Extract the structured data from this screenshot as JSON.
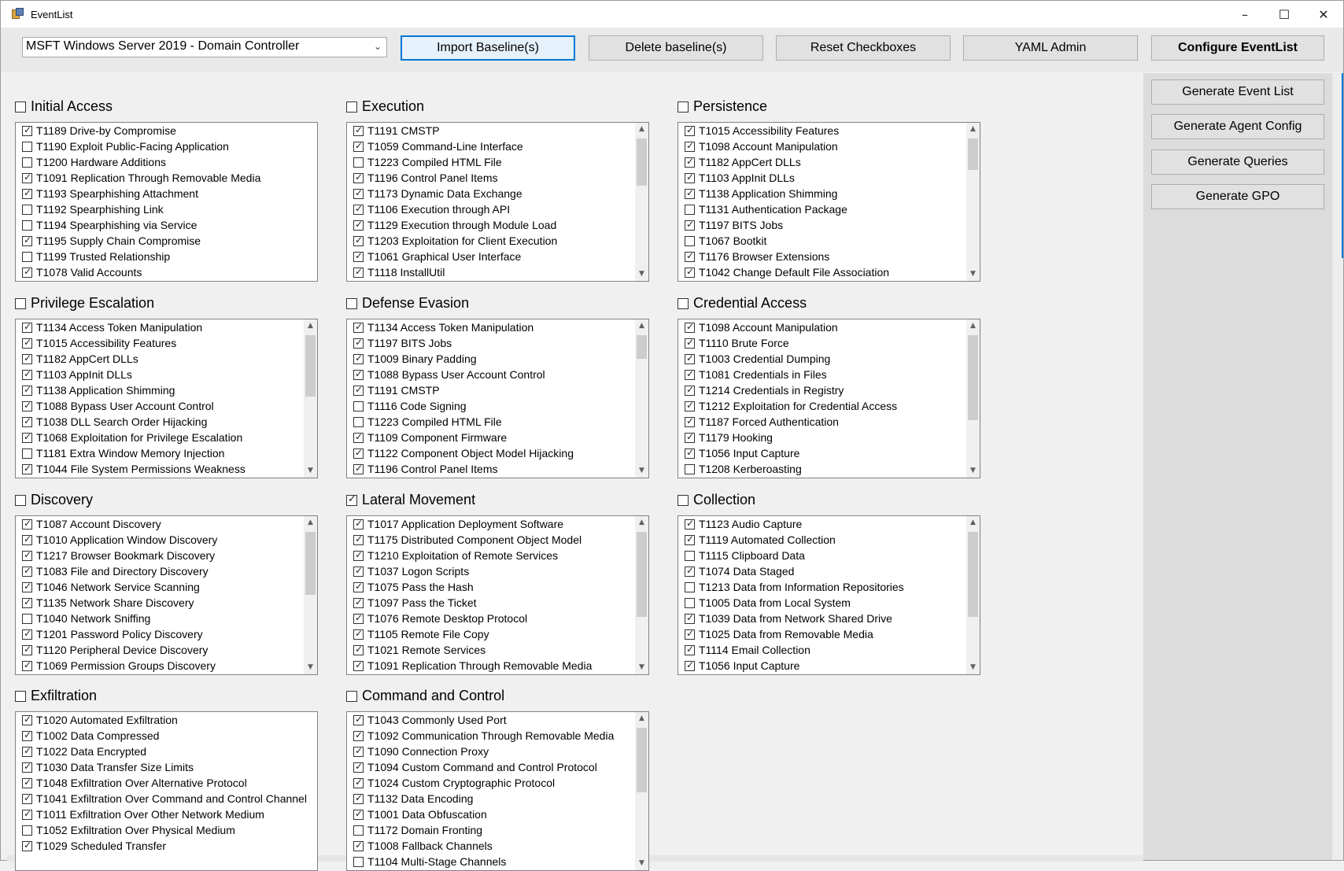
{
  "window": {
    "title": "EventList",
    "controls": [
      "minimize-icon",
      "maximize-icon",
      "close-icon"
    ]
  },
  "toolbar": {
    "baseline_selected": "MSFT Windows Server 2019 - Domain Controller",
    "import_label": "Import Baseline(s)",
    "delete_label": "Delete baseline(s)",
    "reset_label": "Reset Checkboxes",
    "yaml_label": "YAML Admin",
    "configure_label": "Configure EventList"
  },
  "sidepanel": {
    "generate_event_list": "Generate Event List",
    "generate_agent_config": "Generate Agent Config",
    "generate_queries": "Generate Queries",
    "generate_gpo": "Generate GPO"
  },
  "groups": [
    {
      "title": "Initial Access",
      "checked": false,
      "has_scroll": false,
      "items": [
        {
          "label": "T1189 Drive-by Compromise",
          "checked": true
        },
        {
          "label": "T1190 Exploit Public-Facing Application",
          "checked": false
        },
        {
          "label": "T1200 Hardware Additions",
          "checked": false
        },
        {
          "label": "T1091 Replication Through Removable Media",
          "checked": true
        },
        {
          "label": "T1193 Spearphishing Attachment",
          "checked": true
        },
        {
          "label": "T1192 Spearphishing Link",
          "checked": false
        },
        {
          "label": "T1194 Spearphishing via Service",
          "checked": false
        },
        {
          "label": "T1195 Supply Chain Compromise",
          "checked": true
        },
        {
          "label": "T1199 Trusted Relationship",
          "checked": false
        },
        {
          "label": "T1078 Valid Accounts",
          "checked": true
        }
      ]
    },
    {
      "title": "Execution",
      "checked": false,
      "has_scroll": true,
      "items": [
        {
          "label": "T1191 CMSTP",
          "checked": true
        },
        {
          "label": "T1059 Command-Line Interface",
          "checked": true
        },
        {
          "label": "T1223 Compiled HTML File",
          "checked": false
        },
        {
          "label": "T1196 Control Panel Items",
          "checked": true
        },
        {
          "label": "T1173 Dynamic Data Exchange",
          "checked": true
        },
        {
          "label": "T1106 Execution through API",
          "checked": true
        },
        {
          "label": "T1129 Execution through Module Load",
          "checked": true
        },
        {
          "label": "T1203 Exploitation for Client Execution",
          "checked": true
        },
        {
          "label": "T1061 Graphical User Interface",
          "checked": true
        },
        {
          "label": "T1118 InstallUtil",
          "checked": true
        }
      ]
    },
    {
      "title": "Persistence",
      "checked": false,
      "has_scroll": true,
      "items": [
        {
          "label": "T1015 Accessibility Features",
          "checked": true
        },
        {
          "label": "T1098 Account Manipulation",
          "checked": true
        },
        {
          "label": "T1182 AppCert DLLs",
          "checked": true
        },
        {
          "label": "T1103 AppInit DLLs",
          "checked": true
        },
        {
          "label": "T1138 Application Shimming",
          "checked": true
        },
        {
          "label": "T1131 Authentication Package",
          "checked": false
        },
        {
          "label": "T1197 BITS Jobs",
          "checked": true
        },
        {
          "label": "T1067 Bootkit",
          "checked": false
        },
        {
          "label": "T1176 Browser Extensions",
          "checked": true
        },
        {
          "label": "T1042 Change Default File Association",
          "checked": true
        }
      ]
    },
    {
      "title": "Privilege Escalation",
      "checked": false,
      "has_scroll": true,
      "items": [
        {
          "label": "T1134 Access Token Manipulation",
          "checked": true
        },
        {
          "label": "T1015 Accessibility Features",
          "checked": true
        },
        {
          "label": "T1182 AppCert DLLs",
          "checked": true
        },
        {
          "label": "T1103 AppInit DLLs",
          "checked": true
        },
        {
          "label": "T1138 Application Shimming",
          "checked": true
        },
        {
          "label": "T1088 Bypass User Account Control",
          "checked": true
        },
        {
          "label": "T1038 DLL Search Order Hijacking",
          "checked": true
        },
        {
          "label": "T1068 Exploitation for Privilege Escalation",
          "checked": true
        },
        {
          "label": "T1181 Extra Window Memory Injection",
          "checked": false
        },
        {
          "label": "T1044 File System Permissions Weakness",
          "checked": true
        }
      ]
    },
    {
      "title": "Defense Evasion",
      "checked": false,
      "has_scroll": true,
      "items": [
        {
          "label": "T1134 Access Token Manipulation",
          "checked": true
        },
        {
          "label": "T1197 BITS Jobs",
          "checked": true
        },
        {
          "label": "T1009 Binary Padding",
          "checked": true
        },
        {
          "label": "T1088 Bypass User Account Control",
          "checked": true
        },
        {
          "label": "T1191 CMSTP",
          "checked": true
        },
        {
          "label": "T1116 Code Signing",
          "checked": false
        },
        {
          "label": "T1223 Compiled HTML File",
          "checked": false
        },
        {
          "label": "T1109 Component Firmware",
          "checked": true
        },
        {
          "label": "T1122 Component Object Model Hijacking",
          "checked": true
        },
        {
          "label": "T1196 Control Panel Items",
          "checked": true
        }
      ]
    },
    {
      "title": "Credential Access",
      "checked": false,
      "has_scroll": true,
      "items": [
        {
          "label": "T1098 Account Manipulation",
          "checked": true
        },
        {
          "label": "T1110 Brute Force",
          "checked": true
        },
        {
          "label": "T1003 Credential Dumping",
          "checked": true
        },
        {
          "label": "T1081 Credentials in Files",
          "checked": true
        },
        {
          "label": "T1214 Credentials in Registry",
          "checked": true
        },
        {
          "label": "T1212 Exploitation for Credential Access",
          "checked": true
        },
        {
          "label": "T1187 Forced Authentication",
          "checked": true
        },
        {
          "label": "T1179 Hooking",
          "checked": true
        },
        {
          "label": "T1056 Input Capture",
          "checked": true
        },
        {
          "label": "T1208 Kerberoasting",
          "checked": false
        }
      ]
    },
    {
      "title": "Discovery",
      "checked": false,
      "has_scroll": true,
      "items": [
        {
          "label": "T1087 Account Discovery",
          "checked": true
        },
        {
          "label": "T1010 Application Window Discovery",
          "checked": true
        },
        {
          "label": "T1217 Browser Bookmark Discovery",
          "checked": true
        },
        {
          "label": "T1083 File and Directory Discovery",
          "checked": true
        },
        {
          "label": "T1046 Network Service Scanning",
          "checked": true
        },
        {
          "label": "T1135 Network Share Discovery",
          "checked": true
        },
        {
          "label": "T1040 Network Sniffing",
          "checked": false
        },
        {
          "label": "T1201 Password Policy Discovery",
          "checked": true
        },
        {
          "label": "T1120 Peripheral Device Discovery",
          "checked": true
        },
        {
          "label": "T1069 Permission Groups Discovery",
          "checked": true
        }
      ]
    },
    {
      "title": "Lateral Movement",
      "checked": true,
      "has_scroll": true,
      "items": [
        {
          "label": "T1017 Application Deployment Software",
          "checked": true
        },
        {
          "label": "T1175 Distributed Component Object Model",
          "checked": true
        },
        {
          "label": "T1210 Exploitation of Remote Services",
          "checked": true
        },
        {
          "label": "T1037 Logon Scripts",
          "checked": true
        },
        {
          "label": "T1075 Pass the Hash",
          "checked": true
        },
        {
          "label": "T1097 Pass the Ticket",
          "checked": true
        },
        {
          "label": "T1076 Remote Desktop Protocol",
          "checked": true
        },
        {
          "label": "T1105 Remote File Copy",
          "checked": true
        },
        {
          "label": "T1021 Remote Services",
          "checked": true
        },
        {
          "label": "T1091 Replication Through Removable Media",
          "checked": true
        }
      ]
    },
    {
      "title": "Collection",
      "checked": false,
      "has_scroll": true,
      "items": [
        {
          "label": "T1123 Audio Capture",
          "checked": true
        },
        {
          "label": "T1119 Automated Collection",
          "checked": true
        },
        {
          "label": "T1115 Clipboard Data",
          "checked": false
        },
        {
          "label": "T1074 Data Staged",
          "checked": true
        },
        {
          "label": "T1213 Data from Information Repositories",
          "checked": false
        },
        {
          "label": "T1005 Data from Local System",
          "checked": false
        },
        {
          "label": "T1039 Data from Network Shared Drive",
          "checked": true
        },
        {
          "label": "T1025  Data from Removable Media",
          "checked": true
        },
        {
          "label": "T1114 Email Collection",
          "checked": true
        },
        {
          "label": "T1056 Input Capture",
          "checked": true
        }
      ]
    },
    {
      "title": "Exfiltration",
      "checked": false,
      "has_scroll": false,
      "items": [
        {
          "label": "T1020 Automated Exfiltration",
          "checked": true
        },
        {
          "label": "T1002 Data Compressed",
          "checked": true
        },
        {
          "label": "T1022 Data Encrypted",
          "checked": true
        },
        {
          "label": "T1030 Data Transfer Size Limits",
          "checked": true
        },
        {
          "label": "T1048 Exfiltration Over Alternative Protocol",
          "checked": true
        },
        {
          "label": "T1041 Exfiltration Over Command and Control Channel",
          "checked": true
        },
        {
          "label": "T1011 Exfiltration Over Other Network Medium",
          "checked": true
        },
        {
          "label": "T1052 Exfiltration Over Physical Medium",
          "checked": false
        },
        {
          "label": "T1029 Scheduled Transfer",
          "checked": true
        }
      ]
    },
    {
      "title": "Command and Control",
      "checked": false,
      "has_scroll": true,
      "items": [
        {
          "label": "T1043 Commonly Used Port",
          "checked": true
        },
        {
          "label": "T1092 Communication Through Removable Media",
          "checked": true
        },
        {
          "label": "T1090 Connection Proxy",
          "checked": true
        },
        {
          "label": "T1094 Custom Command and Control Protocol",
          "checked": true
        },
        {
          "label": "T1024 Custom Cryptographic Protocol",
          "checked": true
        },
        {
          "label": "T1132 Data Encoding",
          "checked": true
        },
        {
          "label": "T1001 Data Obfuscation",
          "checked": true
        },
        {
          "label": "T1172 Domain Fronting",
          "checked": false
        },
        {
          "label": "T1008 Fallback Channels",
          "checked": true
        },
        {
          "label": "T1104 Multi-Stage Channels",
          "checked": false
        }
      ]
    }
  ]
}
